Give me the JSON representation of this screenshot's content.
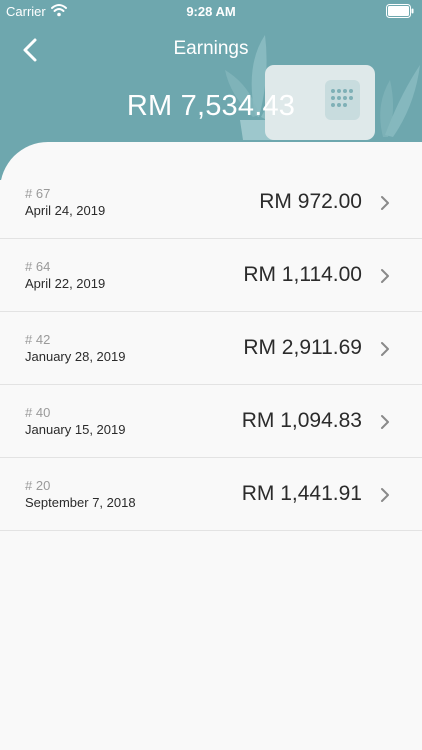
{
  "status_bar": {
    "carrier": "Carrier",
    "time": "9:28 AM"
  },
  "header": {
    "back_icon": "chevron-left-icon",
    "title": "Earnings",
    "total": "RM 7,534.43",
    "background_color": "#6ea7ae"
  },
  "earnings": [
    {
      "number": "# 67",
      "date": "April 24, 2019",
      "amount": "RM 972.00"
    },
    {
      "number": "# 64",
      "date": "April 22, 2019",
      "amount": "RM 1,114.00"
    },
    {
      "number": "# 42",
      "date": "January 28, 2019",
      "amount": "RM 2,911.69"
    },
    {
      "number": "# 40",
      "date": "January 15, 2019",
      "amount": "RM 1,094.83"
    },
    {
      "number": "# 20",
      "date": "September 7, 2018",
      "amount": "RM 1,441.91"
    }
  ]
}
